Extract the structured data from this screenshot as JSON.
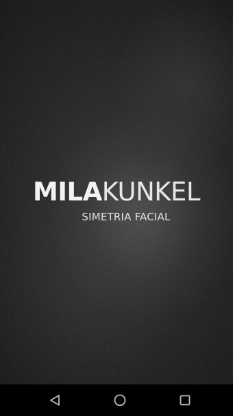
{
  "splash": {
    "brand_bold": "MILA",
    "brand_light": "KUNKEL",
    "tagline": "SIMETRIA FACIAL"
  },
  "navbar": {
    "icons": [
      "back-icon",
      "home-icon",
      "recents-icon"
    ],
    "icon_color": "#bdbdbd"
  },
  "colors": {
    "background": "#141414",
    "text": "#f2f2f2"
  }
}
